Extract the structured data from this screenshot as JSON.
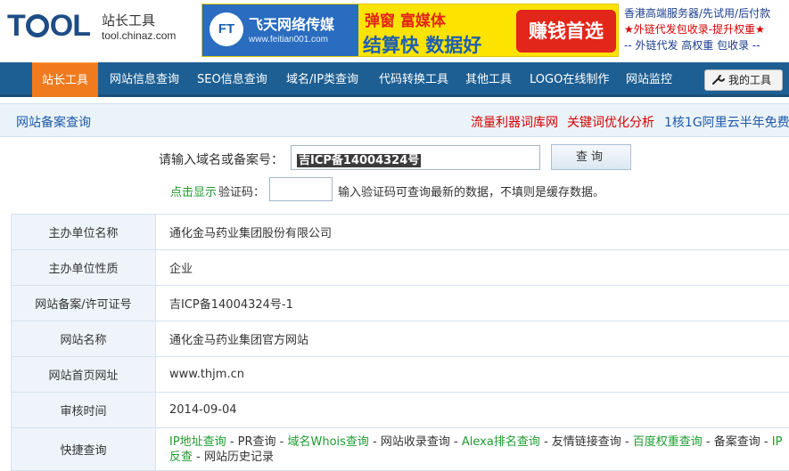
{
  "header": {
    "logo_word_pre": "T",
    "logo_word_post": "OL",
    "logo_cn": "站长工具",
    "logo_url": "tool.chinaz.com",
    "ad": {
      "icon": "FT",
      "brand": "飞天网络传媒",
      "site": "www.feitian001.com",
      "line1": "弹窗 富媒体",
      "line2": "结算快 数据好",
      "pill": "赚钱首选"
    },
    "promo": {
      "line1": "香港高端服务器/先试用/后付款",
      "line2": "★外链代发包收录-提升权重★",
      "line3": "-- 外链代发 高权重 包收录 --"
    }
  },
  "nav": {
    "items": [
      {
        "label": "站长工具"
      },
      {
        "label": "网站信息查询"
      },
      {
        "label": "SEO信息查询"
      },
      {
        "label": "域名/IP类查询"
      },
      {
        "label": "代码转换工具"
      },
      {
        "label": "其他工具"
      },
      {
        "label": "LOGO在线制作"
      },
      {
        "label": "网站监控"
      }
    ],
    "my_tools": "我的工具"
  },
  "subbar": {
    "title": "网站备案查询",
    "links": [
      {
        "label": "流量利器词库网"
      },
      {
        "label": "关键词优化分析"
      },
      {
        "label": "1核1G阿里云半年免费"
      }
    ]
  },
  "search": {
    "label": "请输入域名或备案号：",
    "value": "吉ICP备14004324号",
    "button": "查询",
    "captcha_link": "点击显示",
    "captcha_label": "验证码：",
    "captcha_value": "",
    "captcha_hint": "输入验证码可查询最新的数据，不填则是缓存数据。"
  },
  "table": {
    "rows": [
      {
        "key": "主办单位名称",
        "value": "通化金马药业集团股份有限公司"
      },
      {
        "key": "主办单位性质",
        "value": "企业"
      },
      {
        "key": "网站备案/许可证号",
        "value": "吉ICP备14004324号-1"
      },
      {
        "key": "网站名称",
        "value": "通化金马药业集团官方网站"
      },
      {
        "key": "网站首页网址",
        "value": "www.thjm.cn"
      },
      {
        "key": "审核时间",
        "value": "2014-09-04"
      }
    ],
    "quick": {
      "key": "快捷查询",
      "links": [
        {
          "label": "IP地址查询",
          "color": "green"
        },
        {
          "label": "PR查询",
          "color": "dark"
        },
        {
          "label": "域名Whois查询",
          "color": "green"
        },
        {
          "label": "网站收录查询",
          "color": "dark"
        },
        {
          "label": "Alexa排名查询",
          "color": "green"
        },
        {
          "label": "友情链接查询",
          "color": "dark"
        },
        {
          "label": "百度权重查询",
          "color": "green"
        },
        {
          "label": "备案查询",
          "color": "dark"
        },
        {
          "label": "IP反查",
          "color": "green"
        },
        {
          "label": "网站历史记录",
          "color": "dark"
        }
      ],
      "separator": " - "
    }
  },
  "colors": {
    "nav_bg": "#1d5f93",
    "nav_active": "#f07b1e",
    "link_blue": "#1e5aa8",
    "link_red": "#d50000",
    "link_green": "#1e9b2f"
  }
}
